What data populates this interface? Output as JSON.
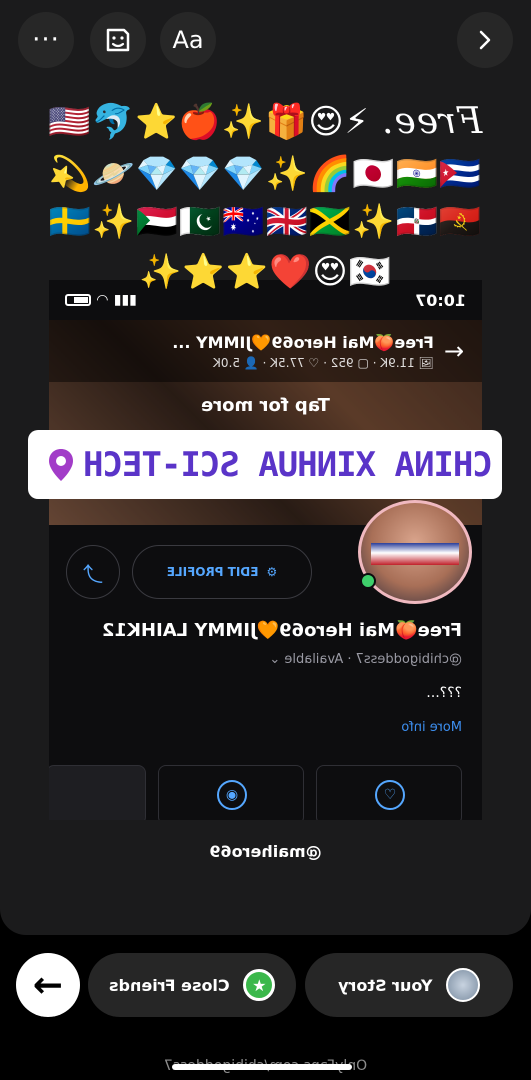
{
  "toolbar": {
    "more_label": "···",
    "sticker_icon": "sticker-icon",
    "text_label": "Aa",
    "next_icon": "chevron-right-icon"
  },
  "caption": {
    "line1_emojis": "🇺🇸🐬⭐🍎✨🎁😍⚡",
    "free_word": "Free.",
    "line2": "💫🪐💎💎💎✨🌈🇯🇵🇮🇳🇨🇺",
    "line3": "🇸🇪✨🇸🇩🇵🇰🇦🇺🇬🇧🇯🇲✨🇩🇴🇦🇴",
    "line4": "✨⭐⭐❤️😍🇰🇷"
  },
  "screenshot": {
    "time": "10:07",
    "share_title": "Free🍑Mai Hero69🧡JIMMY ...",
    "share_stats": "🖼 11.9K · ▢ 952 · ♡ 77.5K · 👤 5.0K",
    "tap_more": "Tap for more",
    "edit_profile": "EDIT PROFILE",
    "profile_name": "Free🍑Mai Hero69🧡JIMMY LAIHK12",
    "profile_handle": "@chibigoddess7 · Available ⌄",
    "bio": "???...",
    "more_info": "More info"
  },
  "location_sticker": {
    "text": "CHINA XINHUA SCI-TECH",
    "color": "#5a34c8"
  },
  "mention": "@maihero69",
  "bottom": {
    "close_friends_label": "Close Friends",
    "your_story_label": "Your Story"
  },
  "watermark": "OnlyFans.com/chibigoddess7"
}
